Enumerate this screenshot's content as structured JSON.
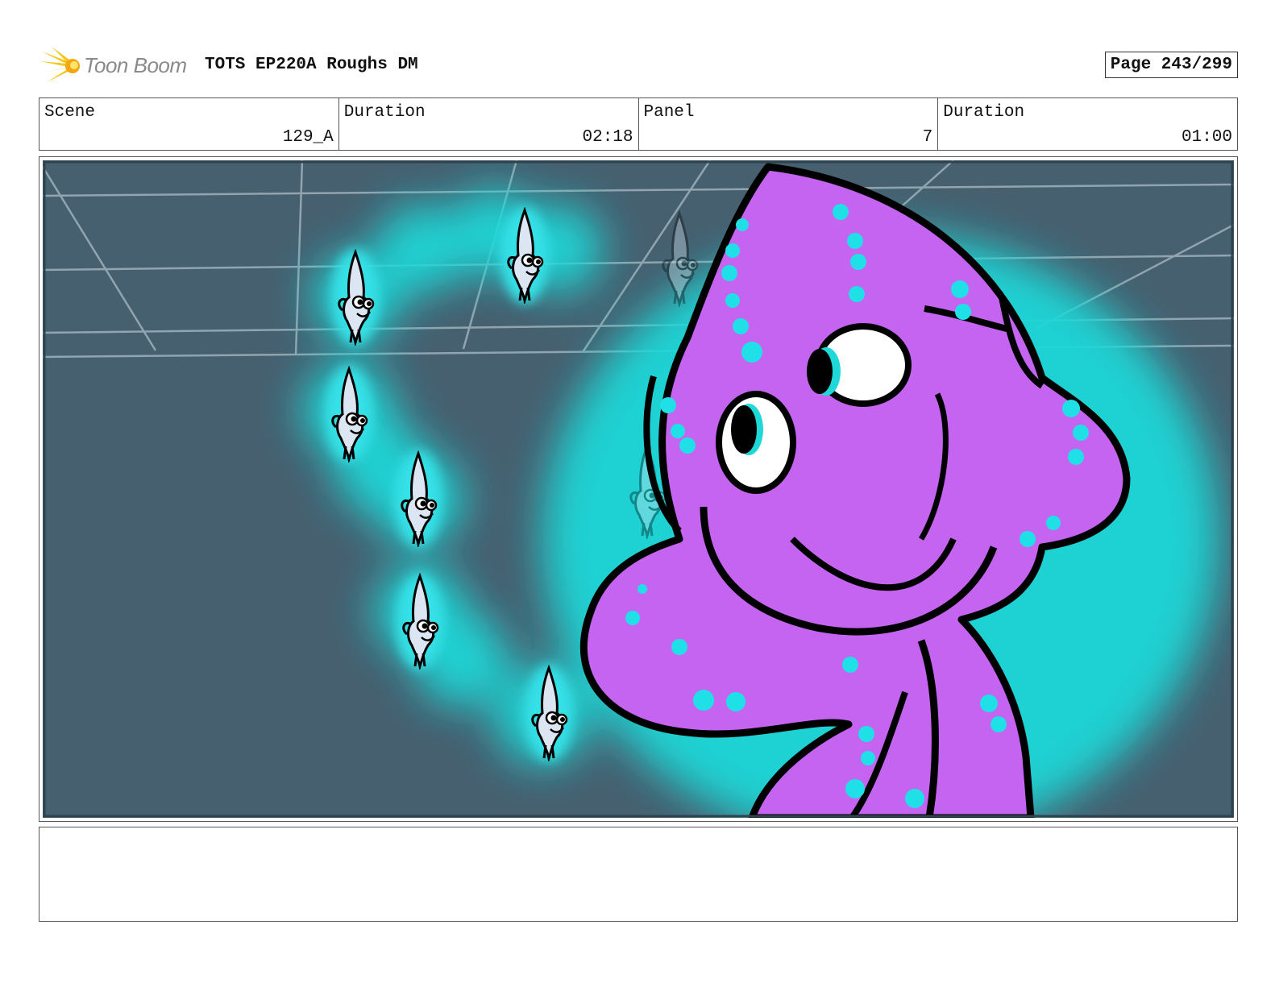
{
  "header": {
    "logo_text": "Toon Boom",
    "title": "TOTS EP220A Roughs DM",
    "page": "Page 243/299"
  },
  "info": {
    "scene_label": "Scene",
    "scene_value": "129_A",
    "duration_label": "Duration",
    "duration_value": "02:18",
    "panel_label": "Panel",
    "panel_value": "7",
    "panel_duration_label": "Duration",
    "panel_duration_value": "01:00"
  },
  "panel": {
    "background_color": "#466070",
    "glow_color": "#1fd8d8",
    "character_color": "#c564f0",
    "dot_color": "#1fe0e6"
  },
  "notes": {
    "text": ""
  }
}
